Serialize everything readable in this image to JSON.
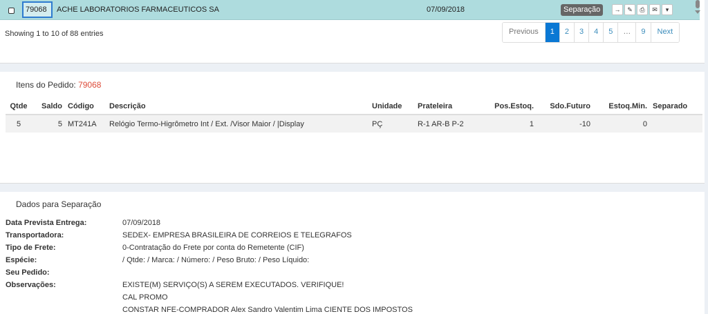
{
  "orders_list": {
    "selected_row": {
      "id": "79068",
      "client": "ACHE LABORATORIOS FARMACEUTICOS SA",
      "date": "07/09/2018",
      "status": "Separação",
      "actions": [
        {
          "icon": "arrow-right-icon",
          "glyph": "→"
        },
        {
          "icon": "edit-icon",
          "glyph": "✎"
        },
        {
          "icon": "print-icon",
          "glyph": "⎙"
        },
        {
          "icon": "envelope-icon",
          "glyph": "✉"
        },
        {
          "icon": "caret-down-icon",
          "glyph": "▾"
        }
      ]
    },
    "entries_info": "Showing 1 to 10 of 88 entries",
    "pagination": {
      "previous": "Previous",
      "pages": [
        "1",
        "2",
        "3",
        "4",
        "5",
        "…",
        "9"
      ],
      "active": "1",
      "next": "Next"
    }
  },
  "items_panel": {
    "title_label": "Itens do Pedido:",
    "order_number": "79068",
    "columns": [
      "Qtde",
      "Saldo",
      "Código",
      "Descrição",
      "Unidade",
      "Prateleira",
      "Pos.Estoq.",
      "Sdo.Futuro",
      "Estoq.Min.",
      "Separado"
    ],
    "rows": [
      [
        "5",
        "5",
        "MT241A",
        "Relógio Termo-Higrômetro Int / Ext. /Visor Maior / |Display",
        "PÇ",
        "R-1 AR-B P-2",
        "1",
        "-10",
        "0",
        ""
      ]
    ]
  },
  "separation_panel": {
    "title": "Dados para Separação",
    "fields": [
      {
        "label": "Data Prevista Entrega:",
        "value": "07/09/2018"
      },
      {
        "label": "Transportadora:",
        "value": "SEDEX- EMPRESA BRASILEIRA DE CORREIOS E TELEGRAFOS"
      },
      {
        "label": "Tipo de Frete:",
        "value": "0-Contratação do Frete por conta do Remetente (CIF)"
      },
      {
        "label": "Espécie:",
        "value": " / Qtde:  / Marca:  / Número:  / Peso Bruto:  / Peso Líquido:"
      },
      {
        "label": "Seu Pedido:",
        "value": ""
      },
      {
        "label": "Observações:",
        "value": "EXISTE(M) SERVIÇO(S) A SEREM EXECUTADOS. VERIFIQUE!"
      },
      {
        "label": "",
        "value": "CAL PROMO"
      },
      {
        "label": "",
        "value": "CONSTAR NFE-COMPRADOR Alex Sandro Valentim Lima CIENTE DOS IMPOSTOS"
      }
    ]
  }
}
